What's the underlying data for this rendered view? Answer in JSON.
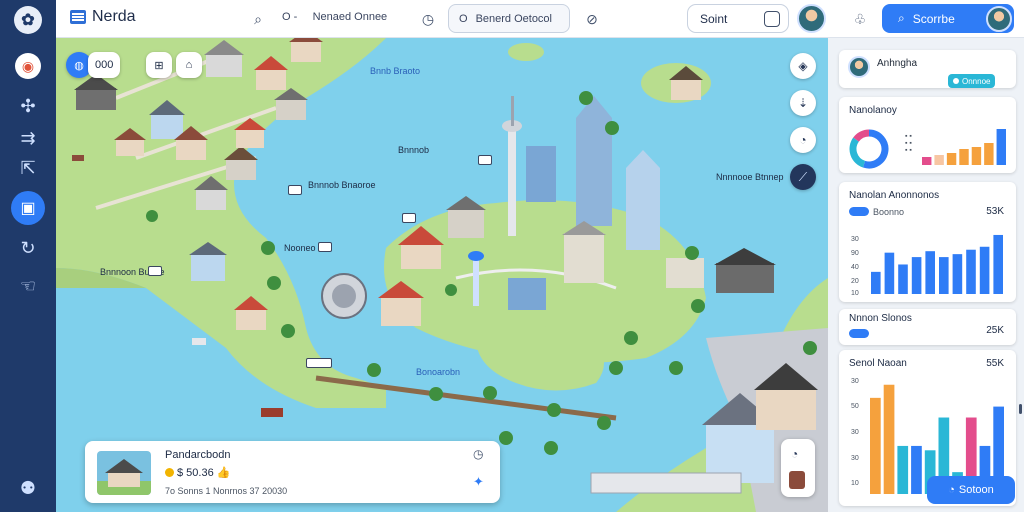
{
  "app": {
    "title": "Nerda",
    "colors": {
      "primary": "#2f7cf6",
      "sidebar": "#1f3a6a",
      "water": "#7fd0ec",
      "land": "#b8dd8e"
    }
  },
  "sidebar": {
    "items": [
      {
        "icon": "pin-icon",
        "glyph": "◉"
      },
      {
        "icon": "puzzle-icon",
        "glyph": "✣"
      },
      {
        "icon": "share-icon",
        "glyph": "⇉"
      },
      {
        "icon": "export-icon",
        "glyph": "⇱"
      },
      {
        "icon": "layers-icon",
        "glyph": "▣"
      },
      {
        "icon": "refresh-icon",
        "glyph": "↻"
      },
      {
        "icon": "hand-icon",
        "glyph": "☜"
      },
      {
        "icon": "user-icon",
        "glyph": "⚉"
      }
    ]
  },
  "topbar": {
    "filter1_prefix": "O",
    "filter1_label": "Nenaed Onnee",
    "filter2_prefix": "O",
    "filter2_label": "Benerd Oetocol",
    "search_value": "Soint",
    "cta_label": "Scorrbe"
  },
  "map": {
    "chip_label": "000",
    "labels": [
      {
        "text": "Bnnb Braoto"
      },
      {
        "text": "Bnnnob"
      },
      {
        "text": "Bnnnob Bnaoroe"
      },
      {
        "text": "Nooneo"
      },
      {
        "text": "Nnnnooe Btnnep"
      },
      {
        "text": "Bnnnoon Bunoe"
      },
      {
        "text": "Bonoarobn"
      }
    ],
    "popup": {
      "title": "Pandarcbodn",
      "price": "$ 50.36",
      "meta": "7o Sonns 1 Nonrnos 37 20030"
    }
  },
  "panel": {
    "profile": {
      "name": "Anhngha",
      "badge": "Onnnoe"
    },
    "card1": {
      "title": "Nanolanoy"
    },
    "card2": {
      "title": "Nanolan Anonnonos",
      "sub": "Boonno",
      "value": "53K"
    },
    "card3": {
      "title": "Nnnon Slonos",
      "value": "25K"
    },
    "card4": {
      "title": "Senol Naoan",
      "value": "55K"
    },
    "bottom_button": "Sotoon"
  },
  "chart_data": [
    {
      "type": "pie",
      "slices": [
        {
          "value": 55,
          "color": "#2f7cf6"
        },
        {
          "value": 30,
          "color": "#2ab7d6"
        },
        {
          "value": 15,
          "color": "#e34d8c"
        }
      ]
    },
    {
      "type": "bar",
      "values": [
        4,
        5,
        6,
        8,
        9,
        11,
        18
      ],
      "colors": [
        "#e34d8c",
        "#f7c6a3",
        "#f5a13d",
        "#f5a13d",
        "#f5a13d",
        "#f5a13d",
        "#2f7cf6"
      ]
    },
    {
      "type": "bar",
      "ytick_labels": [
        "30",
        "90",
        "40",
        "20",
        "10"
      ],
      "values": [
        15,
        28,
        20,
        25,
        29,
        25,
        27,
        30,
        32,
        40
      ],
      "colors": [
        "#2f7cf6"
      ]
    },
    {
      "type": "bar",
      "ytick_labels": [
        "30",
        "50",
        "30",
        "30",
        "10"
      ],
      "values": [
        44,
        50,
        22,
        22,
        20,
        35,
        10,
        35,
        22,
        40
      ],
      "colors": [
        "#f5a13d",
        "#f5a13d",
        "#2ab7d6",
        "#2f7cf6",
        "#2ab7d6",
        "#2ab7d6",
        "#2ab7d6",
        "#e34d8c",
        "#2f7cf6",
        "#2f7cf6"
      ]
    }
  ]
}
